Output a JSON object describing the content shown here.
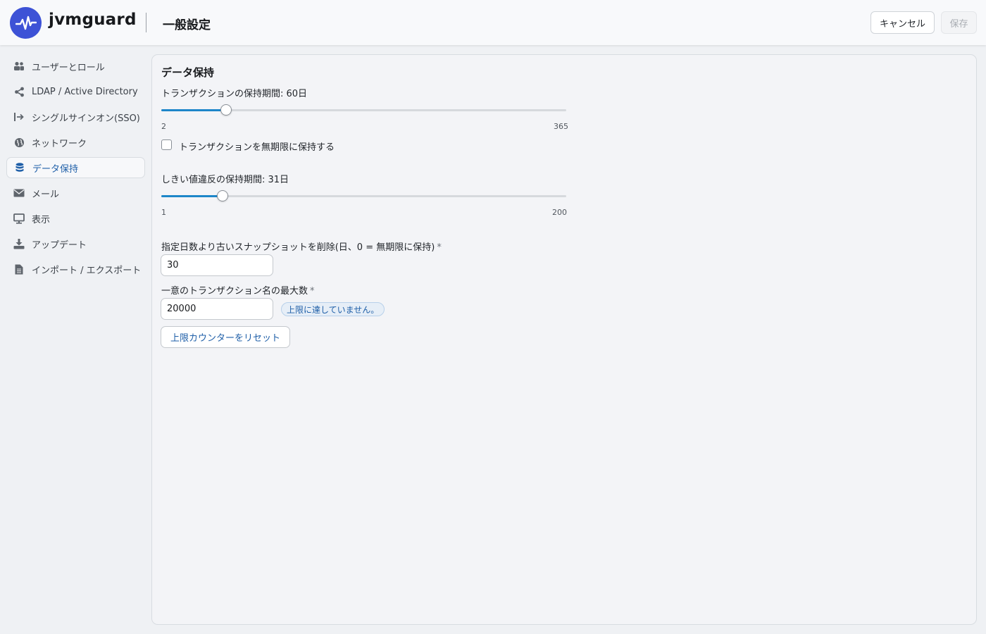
{
  "app": {
    "brand": "jvmguard",
    "logo_icon": "pulse-icon",
    "accent": "#3d52d6"
  },
  "header": {
    "page_title": "一般設定",
    "cancel_label": "キャンセル",
    "save_label": "保存"
  },
  "sidebar": {
    "items": [
      {
        "label": "ユーザーとロール",
        "icon": "users-icon",
        "active": false
      },
      {
        "label": "LDAP / Active Directory",
        "icon": "share-icon",
        "active": false
      },
      {
        "label": "シングルサインオン(SSO)",
        "icon": "sign-in-icon",
        "active": false
      },
      {
        "label": "ネットワーク",
        "icon": "globe-icon",
        "active": false
      },
      {
        "label": "データ保持",
        "icon": "database-icon",
        "active": true
      },
      {
        "label": "メール",
        "icon": "envelope-icon",
        "active": false
      },
      {
        "label": "表示",
        "icon": "monitor-icon",
        "active": false
      },
      {
        "label": "アップデート",
        "icon": "download-icon",
        "active": false
      },
      {
        "label": "インポート / エクスポート",
        "icon": "file-icon",
        "active": false
      }
    ]
  },
  "main": {
    "section_title": "データ保持",
    "transaction_retention": {
      "label": "トランザクションの保持期間: 60日",
      "value": 60,
      "min": 2,
      "max": 365,
      "min_label": "2",
      "max_label": "365"
    },
    "unlimited_checkbox": {
      "label": "トランザクションを無期限に保持する",
      "checked": false
    },
    "threshold_retention": {
      "label": "しきい値違反の保持期間: 31日",
      "value": 31,
      "min": 1,
      "max": 200,
      "min_label": "1",
      "max_label": "200"
    },
    "snapshot_delete": {
      "label": "指定日数より古いスナップショットを削除(日、0 = 無期限に保持)",
      "required_mark": "*",
      "value": "30"
    },
    "max_transaction_names": {
      "label": "一意のトランザクション名の最大数",
      "required_mark": "*",
      "value": "20000",
      "status": "上限に達していません。"
    },
    "reset_button_label": "上限カウンターをリセット"
  },
  "colors": {
    "slider_fill": "#1d86c9",
    "active_nav_text": "#1f5fa8"
  }
}
